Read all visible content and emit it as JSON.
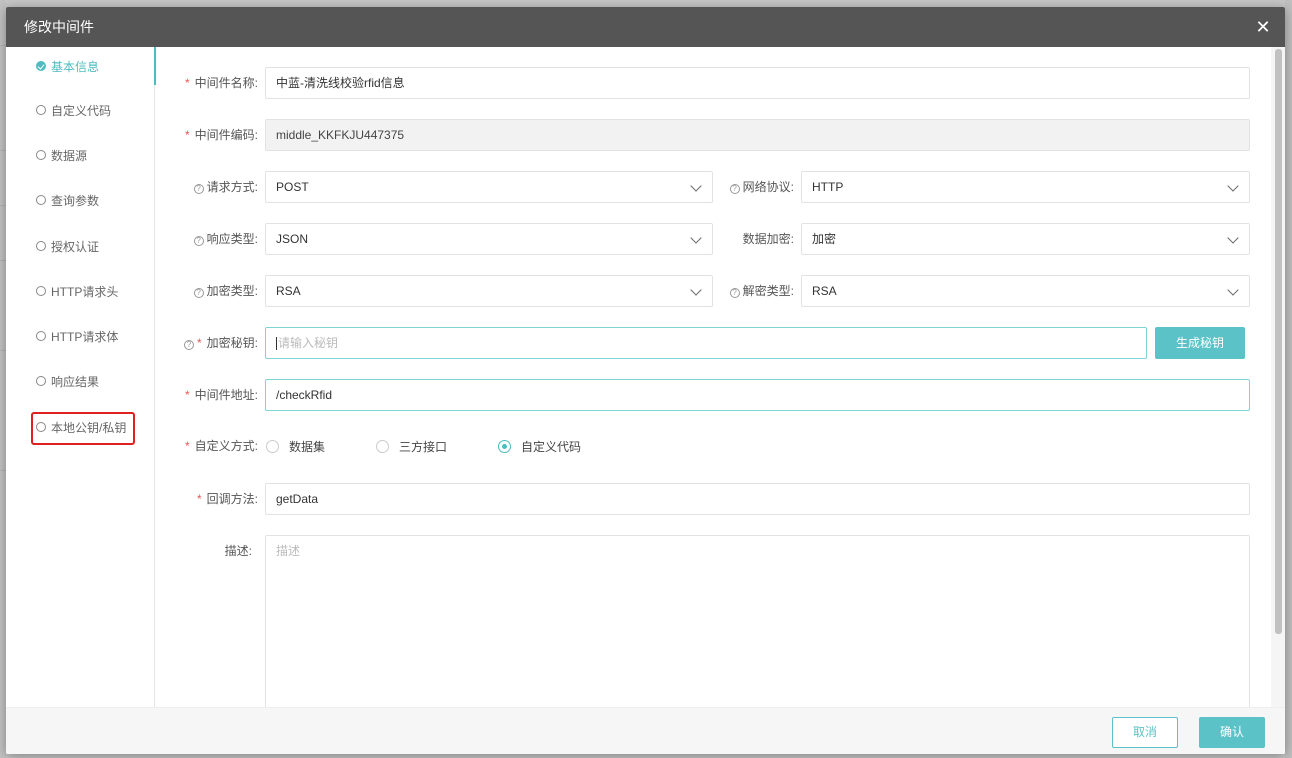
{
  "modal": {
    "title": "修改中间件",
    "close_glyph": "✕"
  },
  "nav": {
    "items": [
      {
        "label": "基本信息",
        "active": true
      },
      {
        "label": "自定义代码"
      },
      {
        "label": "数据源"
      },
      {
        "label": "查询参数"
      },
      {
        "label": "授权认证"
      },
      {
        "label": "HTTP请求头"
      },
      {
        "label": "HTTP请求体"
      },
      {
        "label": "响应结果"
      },
      {
        "label": "本地公钥/私钥",
        "highlighted": true
      }
    ]
  },
  "form": {
    "name": {
      "label": "中间件名称:",
      "value": "中蓝-清洗线校验rfid信息"
    },
    "code": {
      "label": "中间件编码:",
      "value": "middle_KKFKJU447375"
    },
    "request_method": {
      "label": "请求方式:",
      "value": "POST"
    },
    "protocol": {
      "label": "网络协议:",
      "value": "HTTP"
    },
    "response_type": {
      "label": "响应类型:",
      "value": "JSON"
    },
    "data_encrypt": {
      "label": "数据加密:",
      "value": "加密"
    },
    "encrypt_type": {
      "label": "加密类型:",
      "value": "RSA"
    },
    "decrypt_type": {
      "label": "解密类型:",
      "value": "RSA"
    },
    "secret_key": {
      "label": "加密秘钥:",
      "placeholder": "请输入秘钥",
      "button": "生成秘钥"
    },
    "address": {
      "label": "中间件地址:",
      "value": "/checkRfid"
    },
    "custom_mode": {
      "label": "自定义方式:",
      "options": [
        "数据集",
        "三方接口",
        "自定义代码"
      ],
      "selected": "自定义代码"
    },
    "callback": {
      "label": "回调方法:",
      "value": "getData"
    },
    "description": {
      "label": "描述:",
      "placeholder": "描述"
    },
    "required_mark": "*",
    "help_mark": "?"
  },
  "footer": {
    "cancel": "取消",
    "confirm": "确认"
  },
  "colors": {
    "accent": "#5bc2c7",
    "header": "#555555",
    "highlight": "#e02020"
  }
}
